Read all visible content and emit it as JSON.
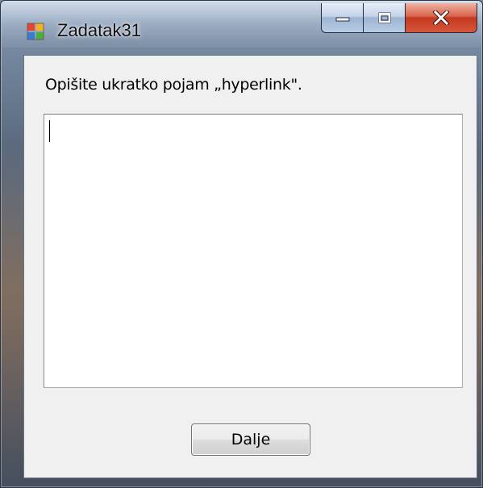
{
  "window": {
    "title": "Zadatak31",
    "icon": "windows-form-icon",
    "controls": {
      "minimize_icon": "minimize-icon",
      "maximize_icon": "maximize-icon",
      "close_icon": "close-icon"
    }
  },
  "form": {
    "prompt": "Opišite ukratko pojam „hyperlink\".",
    "answer_value": "",
    "next_button_label": "Dalje"
  },
  "colors": {
    "close_red": "#c23a1f",
    "client_bg": "#f0f0f0"
  }
}
